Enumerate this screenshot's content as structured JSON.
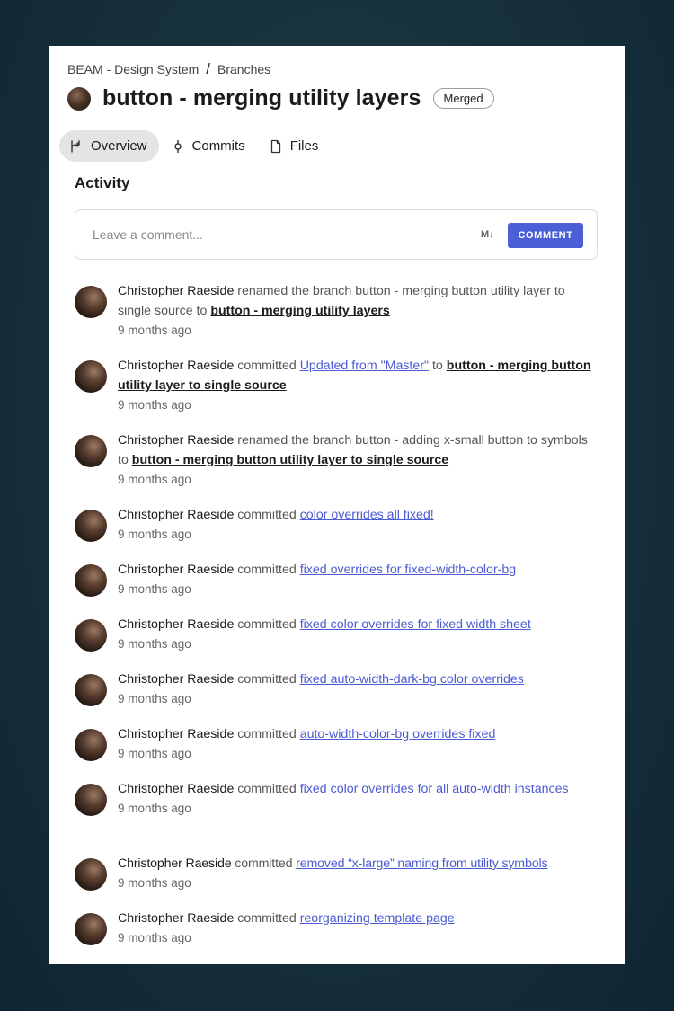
{
  "breadcrumb": {
    "project": "BEAM - Design System",
    "separator": "/",
    "section": "Branches"
  },
  "branch": {
    "title": "button - merging utility layers",
    "status": "Merged"
  },
  "tabs": [
    {
      "label": "Overview",
      "icon": "branch-icon"
    },
    {
      "label": "Commits",
      "icon": "commit-icon"
    },
    {
      "label": "Files",
      "icon": "file-icon"
    }
  ],
  "activity": {
    "title": "Activity",
    "comment_placeholder": "Leave a comment...",
    "markdown_icon": "M↓",
    "comment_button": "COMMENT",
    "items": [
      {
        "author": "Christopher Raeside",
        "action": "renamed the branch button - merging button utility layer to single source to",
        "target": "button - merging utility layers",
        "target_type": "branch",
        "time": "9 months ago"
      },
      {
        "author": "Christopher Raeside",
        "action": "committed",
        "target": "Updated from \"Master\"",
        "target_type": "commit",
        "suffix": "to",
        "suffix_target": "button - merging button utility layer to single source",
        "time": "9 months ago"
      },
      {
        "author": "Christopher Raeside",
        "action": "renamed the branch button - adding x-small button to symbols to",
        "target": "button - merging button utility layer to single source",
        "target_type": "branch",
        "time": "9 months ago"
      },
      {
        "author": "Christopher Raeside",
        "action": "committed",
        "target": "color overrides all fixed!",
        "target_type": "commit",
        "time": "9 months ago"
      },
      {
        "author": "Christopher Raeside",
        "action": "committed",
        "target": "fixed overrides for fixed-width-color-bg",
        "target_type": "commit",
        "time": "9 months ago"
      },
      {
        "author": "Christopher Raeside",
        "action": "committed",
        "target": "fixed color overrides for fixed width sheet",
        "target_type": "commit",
        "time": "9 months ago"
      },
      {
        "author": "Christopher Raeside",
        "action": "committed",
        "target": "fixed auto-width-dark-bg color overrides",
        "target_type": "commit",
        "time": "9 months ago"
      },
      {
        "author": "Christopher Raeside",
        "action": "committed",
        "target": "auto-width-color-bg overrides fixed",
        "target_type": "commit",
        "time": "9 months ago"
      },
      {
        "author": "Christopher Raeside",
        "action": "committed",
        "target": "fixed color overrides for all auto-width instances",
        "target_type": "commit",
        "time": "9 months ago"
      },
      {
        "author": "Christopher Raeside",
        "action": "committed",
        "target": "removed “x-large” naming from utility symbols",
        "target_type": "commit",
        "time": "9 months ago"
      },
      {
        "author": "Christopher Raeside",
        "action": "committed",
        "target": "reorganizing template page",
        "target_type": "commit",
        "time": "9 months ago"
      }
    ]
  },
  "colors": {
    "accent": "#4b5fd6",
    "link": "#4b5bd3",
    "background": "#16303c"
  }
}
